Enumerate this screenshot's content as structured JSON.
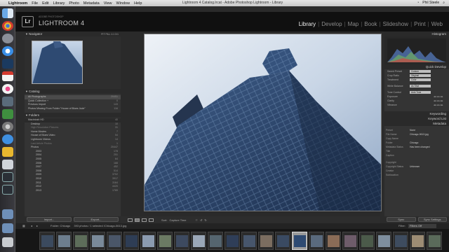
{
  "menubar": {
    "app": "Lightroom",
    "items": [
      "File",
      "Edit",
      "Library",
      "Photo",
      "Metadata",
      "View",
      "Window",
      "Help"
    ],
    "window_title": "Lightroom 4 Catalog.lrcat - Adobe Photoshop Lightroom - Library",
    "user": "Phil Steele"
  },
  "identity": {
    "badge": "Lr",
    "adobe": "ADOBE PHOTOSHOP",
    "product": "LIGHTROOM 4",
    "modules": [
      "Library",
      "Develop",
      "Map",
      "Book",
      "Slideshow",
      "Print",
      "Web"
    ],
    "active_module": "Library"
  },
  "left": {
    "navigator_title": "Navigator",
    "navigator_zoom": "FIT  FILL  1:1  3:1",
    "catalog_title": "Catalog",
    "catalog": [
      {
        "label": "All Photographs",
        "count": "20451"
      },
      {
        "label": "Quick Collection +",
        "count": "0"
      },
      {
        "label": "Previous Import",
        "count": "143"
      },
      {
        "label": "Photos Missing From Folder \"House of Blues Jude\"",
        "count": "116"
      }
    ],
    "folders_title": "Folders",
    "volume": {
      "label": "Macintosh HD",
      "count": "40"
    },
    "folders": [
      {
        "label": "Desktop",
        "count": "10"
      },
      {
        "label": "High Resolution Pictures",
        "count": "31"
      },
      {
        "label": "Home Movies",
        "count": "7"
      },
      {
        "label": "House of Blues Video",
        "count": "54"
      },
      {
        "label": "Lightroom Videos",
        "count": "14"
      },
      {
        "label": "Last Article Photos",
        "count": "1"
      },
      {
        "label": "Photos",
        "count": "20447"
      },
      {
        "label": "2003",
        "count": "178"
      },
      {
        "label": "2004",
        "count": "251"
      },
      {
        "label": "2005",
        "count": "64"
      },
      {
        "label": "2006",
        "count": "188"
      },
      {
        "label": "2007",
        "count": "452"
      },
      {
        "label": "2008",
        "count": "514"
      },
      {
        "label": "2009",
        "count": "3702"
      },
      {
        "label": "2010",
        "count": "3917"
      },
      {
        "label": "2011",
        "count": "3164"
      },
      {
        "label": "2012",
        "count": "4420"
      },
      {
        "label": "2013",
        "count": "1789"
      }
    ],
    "import_label": "Import...",
    "export_label": "Export..."
  },
  "toolbar": {
    "sort_label": "Sort:",
    "sort_value": "Capture Time"
  },
  "right": {
    "histogram_title": "Histogram",
    "quick_develop_title": "Quick Develop",
    "qd_rows": [
      {
        "label": "Saved Preset",
        "value": "Custom"
      },
      {
        "label": "Crop Ratio",
        "value": "Original"
      },
      {
        "label": "Treatment",
        "value": "Color"
      }
    ],
    "wb_row": {
      "label": "White Balance",
      "value": "As Shot"
    },
    "tone_rows": [
      "Tone Control",
      "Exposure",
      "Clarity",
      "Vibrance"
    ],
    "tone_button": "Auto Tone",
    "keywording_title": "Keywording",
    "keyword_list_title": "Keyword List",
    "metadata_title": "Metadata",
    "metadata_preset": {
      "label": "Preset",
      "value": "None"
    },
    "metadata_rows": [
      {
        "label": "File Name",
        "value": "Chicago-0613.jpg"
      },
      {
        "label": "Copy Name",
        "value": ""
      },
      {
        "label": "Folder",
        "value": "Chicago"
      },
      {
        "label": "Metadata Status",
        "value": "Has been changed"
      },
      {
        "label": "Title",
        "value": ""
      },
      {
        "label": "Caption",
        "value": ""
      },
      {
        "label": "Copyright",
        "value": ""
      },
      {
        "label": "Copyright Status",
        "value": "Unknown"
      },
      {
        "label": "Creator",
        "value": ""
      },
      {
        "label": "Sublocation",
        "value": ""
      }
    ],
    "sync_label": "Sync",
    "sync_settings_label": "Sync Settings"
  },
  "filmstrip": {
    "source": "Folder: Chicago",
    "count": "393 photos / 1 selected",
    "selected_file": "/Chicago-0613.jpg",
    "filter_label": "Filter:",
    "filter_value": "Filters Off"
  }
}
